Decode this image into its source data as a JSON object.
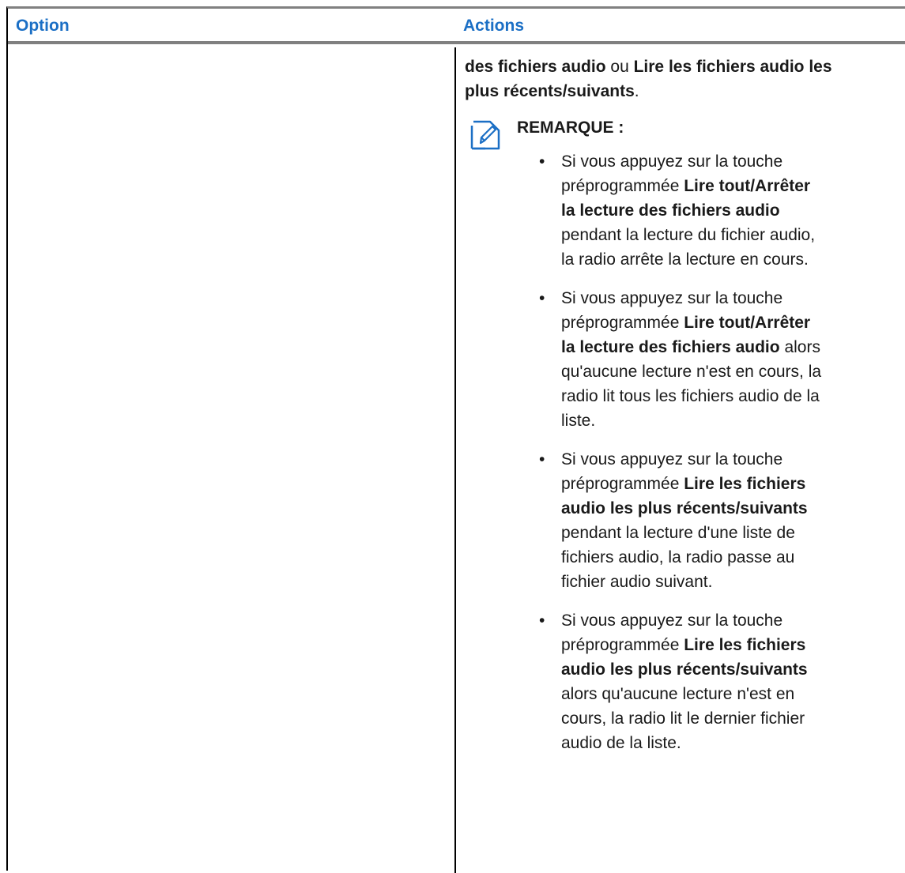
{
  "table": {
    "headers": {
      "option": "Option",
      "actions": "Actions"
    },
    "row": {
      "option": "",
      "actions": {
        "lead": {
          "bold1": "des fichiers audio",
          "text1": " ou ",
          "bold2": "Lire les fichiers audio les plus récents/suivants",
          "text2": "."
        },
        "note": {
          "icon": "note-pencil-icon",
          "title": "REMARQUE :",
          "items": [
            {
              "bullet": "•",
              "pre": "Si vous appuyez sur la touche préprogrammée ",
              "bold": "Lire tout/Arrêter la lecture des fichiers audio",
              "post": " pendant la lecture du fichier audio, la radio arrête la lecture en cours."
            },
            {
              "bullet": "•",
              "pre": "Si vous appuyez sur la touche préprogrammée ",
              "bold": "Lire tout/Arrêter la lecture des fichiers audio",
              "post": " alors qu'aucune lecture n'est en cours, la radio lit tous les fichiers audio de la liste."
            },
            {
              "bullet": "•",
              "pre": "Si vous appuyez sur la touche préprogrammée ",
              "bold": "Lire les fichiers audio les plus récents/suivants",
              "post": " pendant la lecture d'une liste de fichiers audio, la radio passe au fichier audio suivant."
            },
            {
              "bullet": "•",
              "pre": "Si vous appuyez sur la touche préprogrammée ",
              "bold": "Lire les fichiers audio les plus récents/suivants",
              "post": " alors qu'aucune lecture n'est en cours, la radio lit le dernier fichier audio de la liste."
            }
          ]
        }
      }
    }
  },
  "colors": {
    "header_text": "#1b6fc5",
    "rule": "#808080",
    "icon": "#1b6fc5"
  }
}
